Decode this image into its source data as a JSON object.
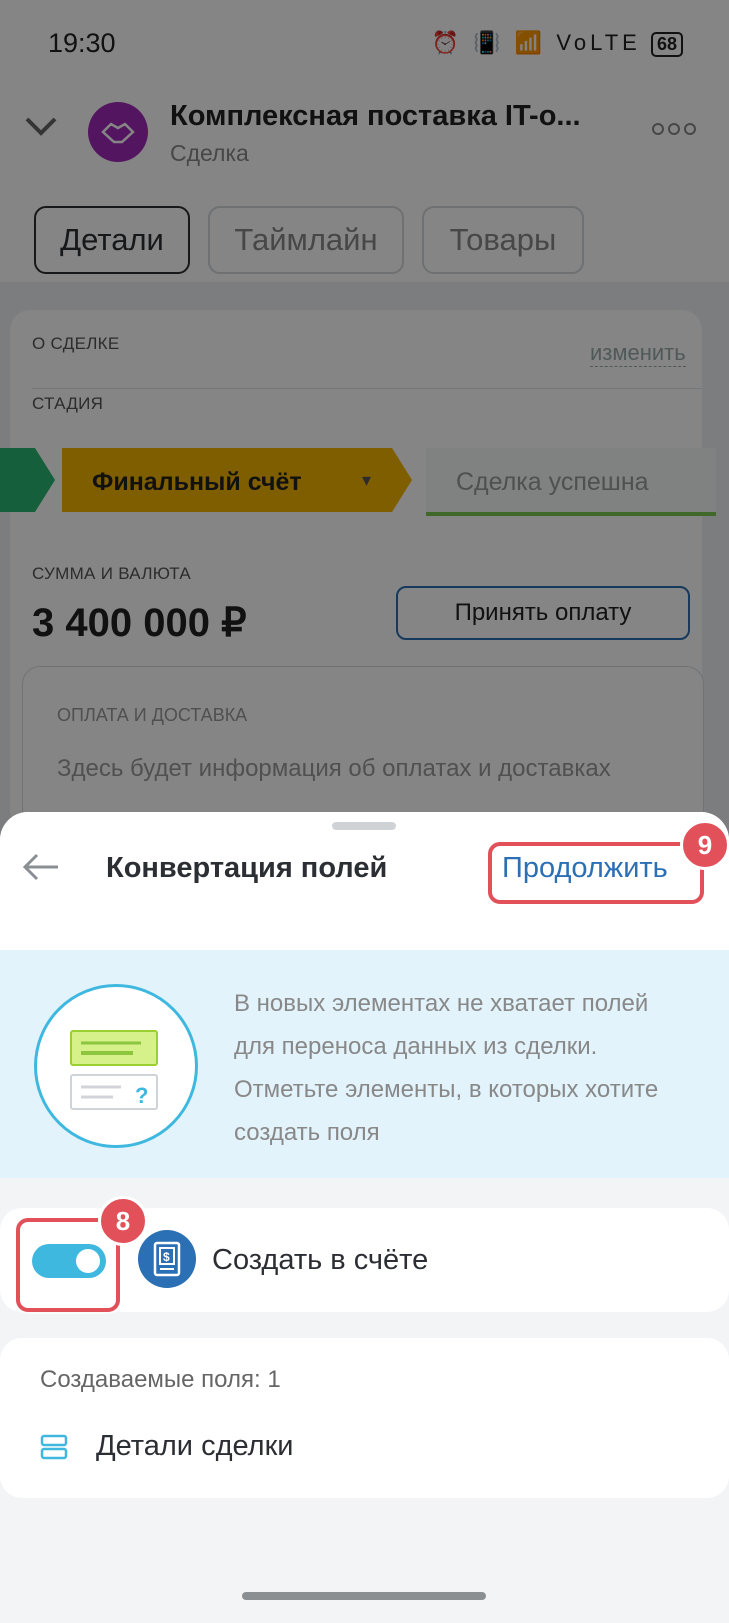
{
  "status_bar": {
    "time": "19:30",
    "icons_text": "⏰ 📳 📶 VoLTE",
    "battery": "68"
  },
  "deal": {
    "avatar_icon": "handshake-icon",
    "title": "Комплексная поставка IT-о...",
    "subtitle": "Сделка",
    "more_icon": "more-dots-icon"
  },
  "tabs": [
    {
      "label": "Детали",
      "active": true
    },
    {
      "label": "Таймлайн",
      "active": false
    },
    {
      "label": "Товары",
      "active": false
    }
  ],
  "about": {
    "section_label": "О СДЕЛКЕ",
    "edit_label": "изменить",
    "stage_label": "СТАДИЯ",
    "stage_current": "Финальный счёт",
    "stage_next": "Сделка успешна",
    "sum_label": "СУММА И ВАЛЮТА",
    "sum_value": "3 400 000 ₽",
    "pay_button": "Принять оплату",
    "payment_section_label": "ОПЛАТА И ДОСТАВКА",
    "payment_text": "Здесь будет информация об оплатах и доставках"
  },
  "sheet": {
    "title": "Конвертация полей",
    "continue_label": "Продолжить",
    "continue_badge": "9",
    "info_text": "В новых элементах не хватает полей для переноса данных из сделки. Отметьте элементы, в которых хотите создать поля",
    "toggle_badge": "8",
    "toggle_on": true,
    "create_label": "Создать в счёте",
    "fields_count_label": "Создаваемые поля: 1",
    "field_item": "Детали сделки"
  },
  "colors": {
    "accent_blue": "#2b6fb5",
    "toggle_blue": "#3fb8e0",
    "stage_yellow": "#f4b400",
    "stage_green": "#2bb673",
    "highlight_red": "#e2515a",
    "info_bg": "#e3f3fb"
  }
}
